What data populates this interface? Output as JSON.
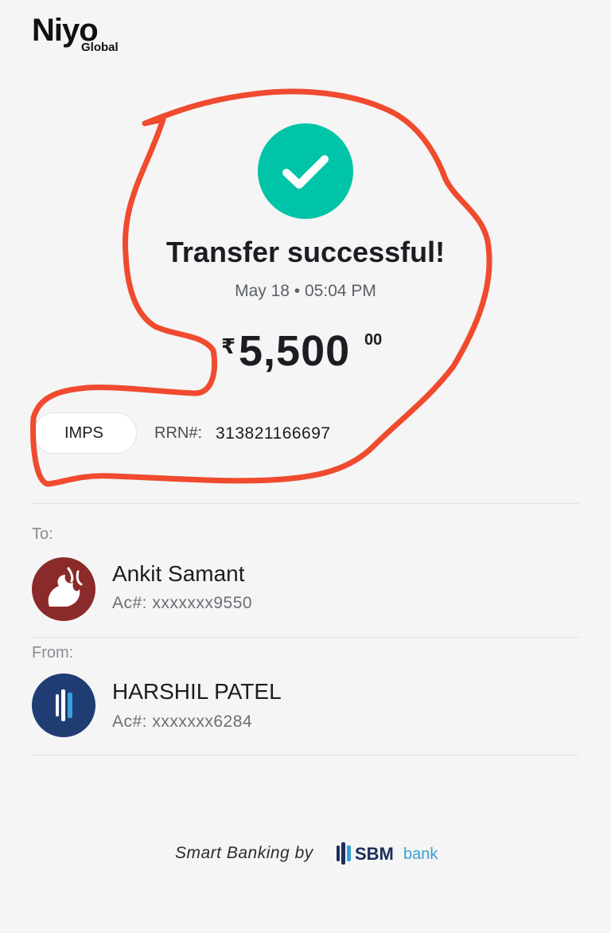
{
  "brand": {
    "logo_main": "Niyo",
    "logo_sub": "Global"
  },
  "transfer": {
    "title": "Transfer successful!",
    "datetime": "May 18 • 05:04 PM",
    "currency_symbol": "₹",
    "amount": "5,500",
    "amount_decimal": "00",
    "mode": "IMPS",
    "rrn_label": "RRN#:",
    "rrn_value": "313821166697"
  },
  "to": {
    "label": "To:",
    "name": "Ankit Samant",
    "account": "Ac#: xxxxxxx9550",
    "avatar_icon": "bank-logo-icon"
  },
  "from": {
    "label": "From:",
    "name": "HARSHIL PATEL",
    "account": "Ac#: xxxxxxx6284",
    "avatar_icon": "sbm-bank-logo-icon"
  },
  "footer": {
    "text": "Smart Banking by",
    "bank_name": "SBM",
    "bank_suffix": "bank"
  },
  "colors": {
    "success": "#00c4a7",
    "annotation": "#f04a2f",
    "to_avatar": "#8b2a2a",
    "from_avatar": "#1f3d73",
    "sbm_blue": "#1c2e5a",
    "sbm_light": "#3a9fd6"
  }
}
